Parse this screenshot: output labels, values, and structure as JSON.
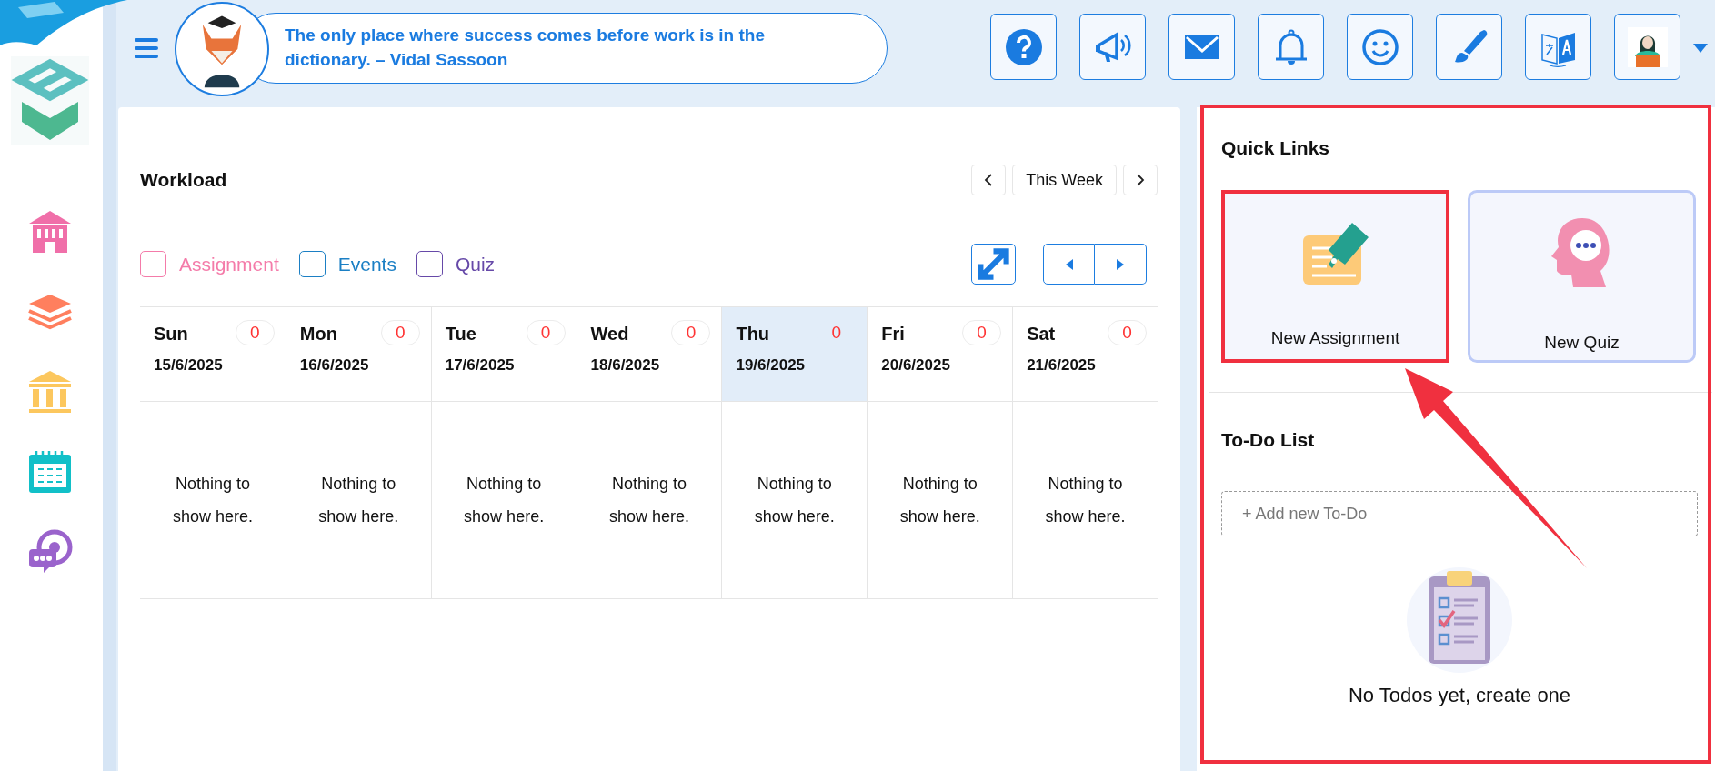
{
  "header": {
    "quote": "The only place where success comes before work is in the dictionary. – Vidal Sassoon"
  },
  "workload": {
    "title": "Workload",
    "week_label": "This Week",
    "legend": [
      {
        "label": "Assignment",
        "color": "#f47ba9",
        "checked": false
      },
      {
        "label": "Events",
        "color": "#1b7fc4",
        "checked": false
      },
      {
        "label": "Quiz",
        "color": "#6649a8",
        "checked": false
      }
    ],
    "days": [
      {
        "name": "Sun",
        "date": "15/6/2025",
        "count": "0",
        "selected": false,
        "empty_text": "Nothing to show here."
      },
      {
        "name": "Mon",
        "date": "16/6/2025",
        "count": "0",
        "selected": false,
        "empty_text": "Nothing to show here."
      },
      {
        "name": "Tue",
        "date": "17/6/2025",
        "count": "0",
        "selected": false,
        "empty_text": "Nothing to show here."
      },
      {
        "name": "Wed",
        "date": "18/6/2025",
        "count": "0",
        "selected": false,
        "empty_text": "Nothing to show here."
      },
      {
        "name": "Thu",
        "date": "19/6/2025",
        "count": "0",
        "selected": true,
        "empty_text": "Nothing to show here."
      },
      {
        "name": "Fri",
        "date": "20/6/2025",
        "count": "0",
        "selected": false,
        "empty_text": "Nothing to show here."
      },
      {
        "name": "Sat",
        "date": "21/6/2025",
        "count": "0",
        "selected": false,
        "empty_text": "Nothing to show here."
      }
    ]
  },
  "quick_links": {
    "title": "Quick Links",
    "items": [
      {
        "label": "New Assignment",
        "kind": "assignment",
        "highlighted": true
      },
      {
        "label": "New Quiz",
        "kind": "quiz",
        "highlighted": false
      }
    ]
  },
  "todo": {
    "title": "To-Do List",
    "placeholder": "+ Add new To-Do",
    "empty_text": "No Todos yet, create one"
  }
}
